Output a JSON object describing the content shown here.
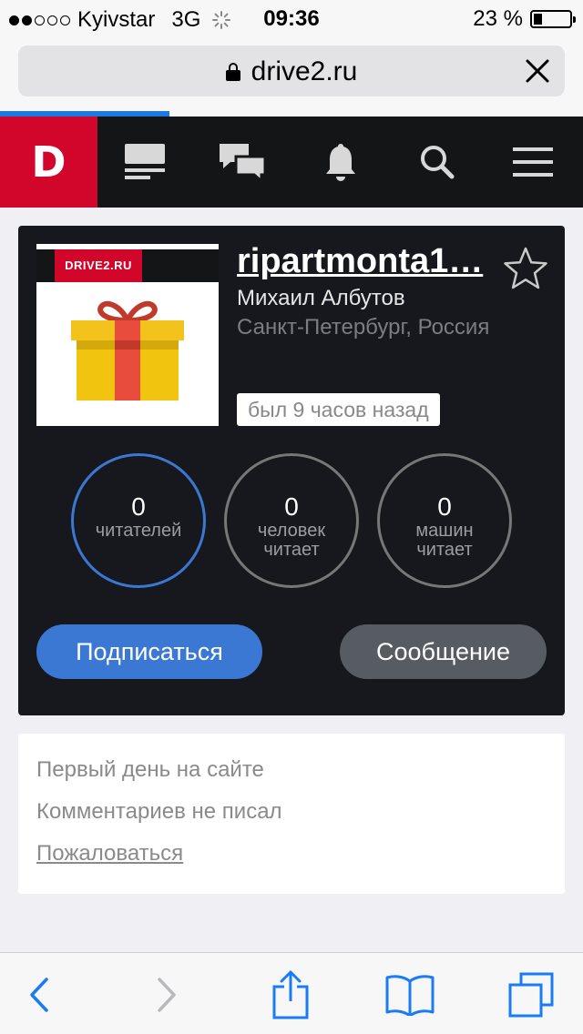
{
  "status_bar": {
    "carrier": "Kyivstar",
    "network": "3G",
    "time": "09:36",
    "battery_text": "23 %",
    "battery_level": 0.23,
    "signal_bars_filled": 2,
    "signal_bars_total": 5
  },
  "url_bar": {
    "url": "drive2.ru",
    "lock_icon": "lock-icon",
    "close_icon": "close-icon",
    "load_progress": 0.29
  },
  "app_header": {
    "logo": "D",
    "brand_color": "#d1062a",
    "nav_icons": [
      "feed-icon",
      "messages-icon",
      "bell-icon",
      "search-icon",
      "menu-icon"
    ]
  },
  "profile": {
    "avatar_label": "DRIVE2.RU",
    "username": "ripartmonta1…",
    "full_name": "Михаил Албутов",
    "location": "Санкт-Петербург, Россия",
    "last_seen": "был 9 часов назад",
    "stats": [
      {
        "value": "0",
        "label": "читателей"
      },
      {
        "value": "0",
        "label": "человек читает"
      },
      {
        "value": "0",
        "label": "машин читает"
      }
    ],
    "subscribe_label": "Подписаться",
    "message_label": "Сообщение",
    "accent_color": "#3a78d4"
  },
  "info": {
    "first_day": "Первый день на сайте",
    "comments": "Комментариев не писал",
    "report": "Пожаловаться"
  },
  "toolbar": {
    "icons": [
      "back-icon",
      "forward-icon",
      "share-icon",
      "bookmarks-icon",
      "tabs-icon"
    ]
  }
}
